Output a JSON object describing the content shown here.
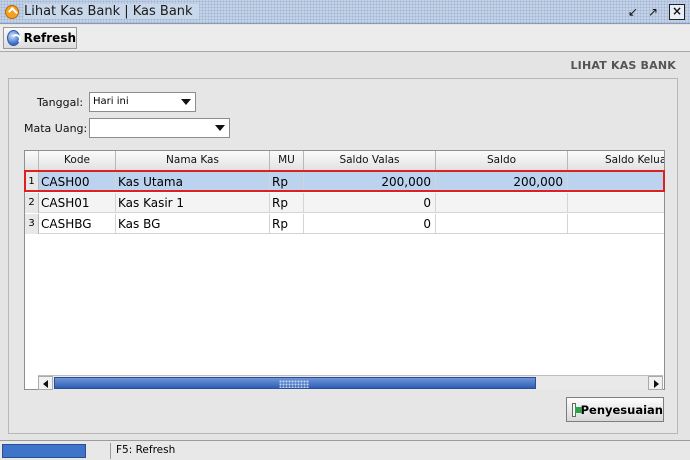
{
  "window": {
    "title": "Lihat Kas Bank | Kas Bank"
  },
  "toolbar": {
    "refresh_label": "Refresh"
  },
  "page": {
    "heading": "LIHAT KAS BANK"
  },
  "filters": {
    "tanggal_label": "Tanggal:",
    "tanggal_value": "Hari ini",
    "mata_uang_label": "Mata Uang:",
    "mata_uang_value": ""
  },
  "table": {
    "columns": [
      "Kode",
      "Nama Kas",
      "MU",
      "Saldo Valas",
      "Saldo",
      "Saldo Keluar"
    ],
    "rows": [
      {
        "num": "1",
        "kode": "CASH00",
        "nama": "Kas Utama",
        "mu": "Rp",
        "saldo_valas": "200,000",
        "saldo": "200,000",
        "saldo_keluar": ""
      },
      {
        "num": "2",
        "kode": "CASH01",
        "nama": "Kas Kasir 1",
        "mu": "Rp",
        "saldo_valas": "0",
        "saldo": "",
        "saldo_keluar": ""
      },
      {
        "num": "3",
        "kode": "CASHBG",
        "nama": "Kas BG",
        "mu": "Rp",
        "saldo_valas": "0",
        "saldo": "",
        "saldo_keluar": ""
      }
    ]
  },
  "actions": {
    "penyesuaian_label": "Penyesuaian"
  },
  "status": {
    "text": "F5: Refresh"
  }
}
